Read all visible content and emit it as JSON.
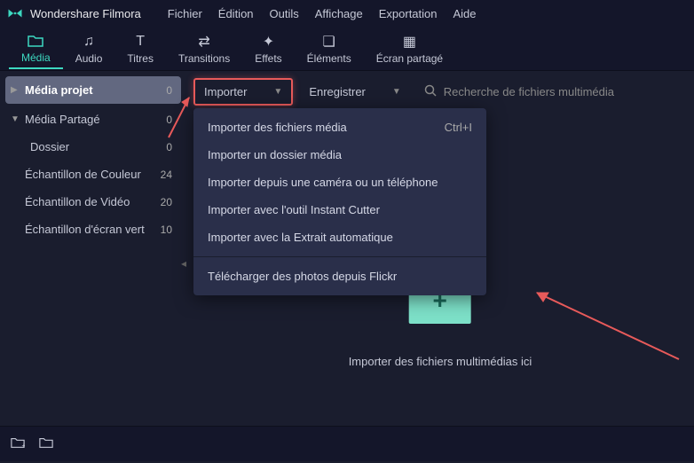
{
  "app": {
    "title": "Wondershare Filmora"
  },
  "menu": {
    "items": [
      "Fichier",
      "Édition",
      "Outils",
      "Affichage",
      "Exportation",
      "Aide"
    ]
  },
  "toolbar": {
    "tabs": [
      {
        "label": "Média",
        "active": true
      },
      {
        "label": "Audio"
      },
      {
        "label": "Titres"
      },
      {
        "label": "Transitions"
      },
      {
        "label": "Effets"
      },
      {
        "label": "Éléments"
      },
      {
        "label": "Écran partagé"
      }
    ]
  },
  "sidebar": {
    "items": [
      {
        "label": "Média projet",
        "count": "0",
        "selected": true,
        "arrow": "▶"
      },
      {
        "label": "Média Partagé",
        "count": "0",
        "arrow": "▼"
      },
      {
        "label": "Dossier",
        "count": "0",
        "indent": true
      },
      {
        "label": "Échantillon de Couleur",
        "count": "24"
      },
      {
        "label": "Échantillon de Vidéo",
        "count": "20"
      },
      {
        "label": "Échantillon d'écran vert",
        "count": "10"
      }
    ]
  },
  "actions": {
    "import_label": "Importer",
    "save_label": "Enregistrer",
    "search_placeholder": "Recherche de fichiers multimédia"
  },
  "import_menu": {
    "items": [
      {
        "label": "Importer des fichiers média",
        "shortcut": "Ctrl+I"
      },
      {
        "label": "Importer un dossier média"
      },
      {
        "label": "Importer depuis une caméra ou un téléphone"
      },
      {
        "label": "Importer avec l'outil Instant Cutter"
      },
      {
        "label": "Importer avec la Extrait automatique"
      }
    ],
    "footer": {
      "label": "Télécharger des photos depuis Flickr"
    }
  },
  "dropzone": {
    "text": "Importer des fichiers multimédias ici"
  },
  "colors": {
    "accent": "#3dd9c1",
    "highlight": "#e85a5a"
  }
}
